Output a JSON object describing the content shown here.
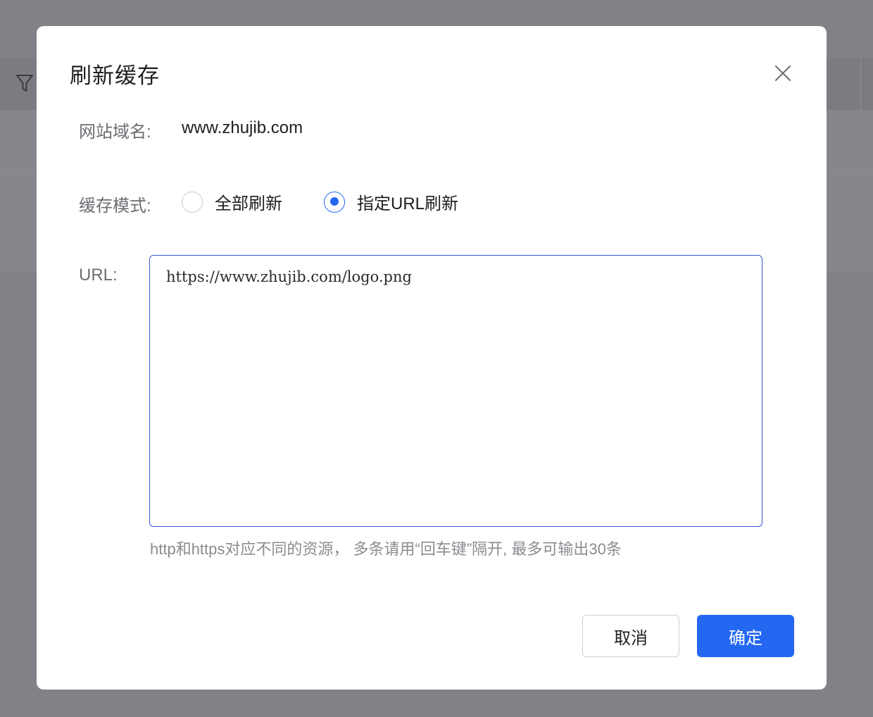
{
  "dialog": {
    "title": "刷新缓存",
    "domain_label": "网站域名:",
    "domain_value": "www.zhujib.com",
    "mode_label": "缓存模式:",
    "mode_options": [
      {
        "label": "全部刷新",
        "checked": false
      },
      {
        "label": "指定URL刷新",
        "checked": true
      }
    ],
    "url_label": "URL:",
    "url_value": "https://www.zhujib.com/logo.png",
    "hint": "http和https对应不同的资源， 多条请用“回车键”隔开, 最多可输出30条",
    "cancel_label": "取消",
    "ok_label": "确定"
  },
  "icons": {
    "close": "close-icon",
    "filter": "filter-icon"
  },
  "colors": {
    "accent": "#2468f2",
    "overlay": "#808288",
    "textarea_border": "#2e5bd6"
  }
}
